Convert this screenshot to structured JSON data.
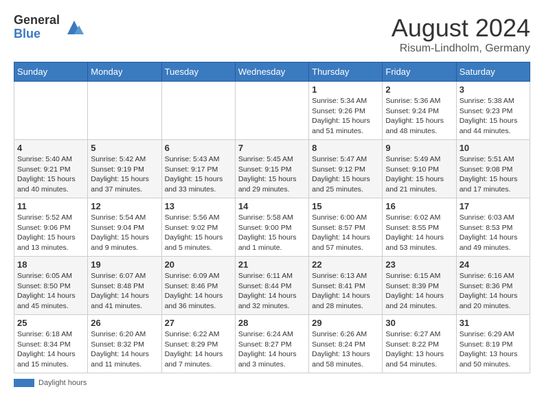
{
  "header": {
    "logo_general": "General",
    "logo_blue": "Blue",
    "month_title": "August 2024",
    "location": "Risum-Lindholm, Germany"
  },
  "days_of_week": [
    "Sunday",
    "Monday",
    "Tuesday",
    "Wednesday",
    "Thursday",
    "Friday",
    "Saturday"
  ],
  "weeks": [
    [
      {
        "day": "",
        "info": ""
      },
      {
        "day": "",
        "info": ""
      },
      {
        "day": "",
        "info": ""
      },
      {
        "day": "",
        "info": ""
      },
      {
        "day": "1",
        "info": "Sunrise: 5:34 AM\nSunset: 9:26 PM\nDaylight: 15 hours\nand 51 minutes."
      },
      {
        "day": "2",
        "info": "Sunrise: 5:36 AM\nSunset: 9:24 PM\nDaylight: 15 hours\nand 48 minutes."
      },
      {
        "day": "3",
        "info": "Sunrise: 5:38 AM\nSunset: 9:23 PM\nDaylight: 15 hours\nand 44 minutes."
      }
    ],
    [
      {
        "day": "4",
        "info": "Sunrise: 5:40 AM\nSunset: 9:21 PM\nDaylight: 15 hours\nand 40 minutes."
      },
      {
        "day": "5",
        "info": "Sunrise: 5:42 AM\nSunset: 9:19 PM\nDaylight: 15 hours\nand 37 minutes."
      },
      {
        "day": "6",
        "info": "Sunrise: 5:43 AM\nSunset: 9:17 PM\nDaylight: 15 hours\nand 33 minutes."
      },
      {
        "day": "7",
        "info": "Sunrise: 5:45 AM\nSunset: 9:15 PM\nDaylight: 15 hours\nand 29 minutes."
      },
      {
        "day": "8",
        "info": "Sunrise: 5:47 AM\nSunset: 9:12 PM\nDaylight: 15 hours\nand 25 minutes."
      },
      {
        "day": "9",
        "info": "Sunrise: 5:49 AM\nSunset: 9:10 PM\nDaylight: 15 hours\nand 21 minutes."
      },
      {
        "day": "10",
        "info": "Sunrise: 5:51 AM\nSunset: 9:08 PM\nDaylight: 15 hours\nand 17 minutes."
      }
    ],
    [
      {
        "day": "11",
        "info": "Sunrise: 5:52 AM\nSunset: 9:06 PM\nDaylight: 15 hours\nand 13 minutes."
      },
      {
        "day": "12",
        "info": "Sunrise: 5:54 AM\nSunset: 9:04 PM\nDaylight: 15 hours\nand 9 minutes."
      },
      {
        "day": "13",
        "info": "Sunrise: 5:56 AM\nSunset: 9:02 PM\nDaylight: 15 hours\nand 5 minutes."
      },
      {
        "day": "14",
        "info": "Sunrise: 5:58 AM\nSunset: 9:00 PM\nDaylight: 15 hours\nand 1 minute."
      },
      {
        "day": "15",
        "info": "Sunrise: 6:00 AM\nSunset: 8:57 PM\nDaylight: 14 hours\nand 57 minutes."
      },
      {
        "day": "16",
        "info": "Sunrise: 6:02 AM\nSunset: 8:55 PM\nDaylight: 14 hours\nand 53 minutes."
      },
      {
        "day": "17",
        "info": "Sunrise: 6:03 AM\nSunset: 8:53 PM\nDaylight: 14 hours\nand 49 minutes."
      }
    ],
    [
      {
        "day": "18",
        "info": "Sunrise: 6:05 AM\nSunset: 8:50 PM\nDaylight: 14 hours\nand 45 minutes."
      },
      {
        "day": "19",
        "info": "Sunrise: 6:07 AM\nSunset: 8:48 PM\nDaylight: 14 hours\nand 41 minutes."
      },
      {
        "day": "20",
        "info": "Sunrise: 6:09 AM\nSunset: 8:46 PM\nDaylight: 14 hours\nand 36 minutes."
      },
      {
        "day": "21",
        "info": "Sunrise: 6:11 AM\nSunset: 8:44 PM\nDaylight: 14 hours\nand 32 minutes."
      },
      {
        "day": "22",
        "info": "Sunrise: 6:13 AM\nSunset: 8:41 PM\nDaylight: 14 hours\nand 28 minutes."
      },
      {
        "day": "23",
        "info": "Sunrise: 6:15 AM\nSunset: 8:39 PM\nDaylight: 14 hours\nand 24 minutes."
      },
      {
        "day": "24",
        "info": "Sunrise: 6:16 AM\nSunset: 8:36 PM\nDaylight: 14 hours\nand 20 minutes."
      }
    ],
    [
      {
        "day": "25",
        "info": "Sunrise: 6:18 AM\nSunset: 8:34 PM\nDaylight: 14 hours\nand 15 minutes."
      },
      {
        "day": "26",
        "info": "Sunrise: 6:20 AM\nSunset: 8:32 PM\nDaylight: 14 hours\nand 11 minutes."
      },
      {
        "day": "27",
        "info": "Sunrise: 6:22 AM\nSunset: 8:29 PM\nDaylight: 14 hours\nand 7 minutes."
      },
      {
        "day": "28",
        "info": "Sunrise: 6:24 AM\nSunset: 8:27 PM\nDaylight: 14 hours\nand 3 minutes."
      },
      {
        "day": "29",
        "info": "Sunrise: 6:26 AM\nSunset: 8:24 PM\nDaylight: 13 hours\nand 58 minutes."
      },
      {
        "day": "30",
        "info": "Sunrise: 6:27 AM\nSunset: 8:22 PM\nDaylight: 13 hours\nand 54 minutes."
      },
      {
        "day": "31",
        "info": "Sunrise: 6:29 AM\nSunset: 8:19 PM\nDaylight: 13 hours\nand 50 minutes."
      }
    ]
  ],
  "footer": {
    "daylight_label": "Daylight hours"
  }
}
